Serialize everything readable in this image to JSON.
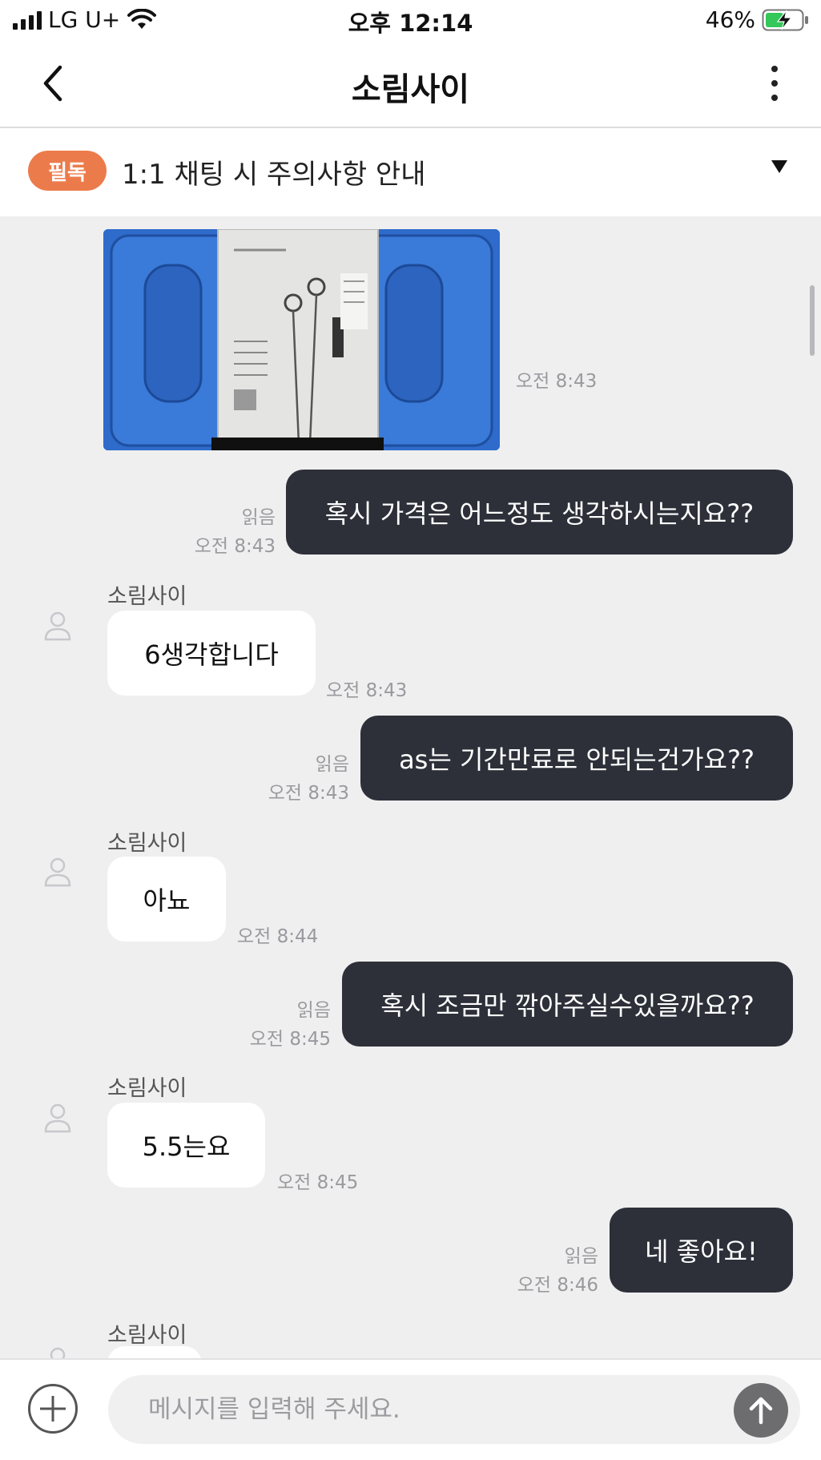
{
  "status_bar": {
    "carrier": "LG U+",
    "time": "오후 12:14",
    "battery": "46%"
  },
  "header": {
    "title": "소림사이"
  },
  "notice": {
    "badge": "필독",
    "text": "1:1 채팅 시 주의사항 안내"
  },
  "messages": [
    {
      "type": "image",
      "time": "오전 8:43",
      "subject": "earphones-box"
    },
    {
      "type": "outgoing",
      "text": "혹시 가격은 어느정도 생각하시는지요??",
      "read": "읽음",
      "time": "오전 8:43"
    },
    {
      "type": "incoming",
      "sender": "소림사이",
      "text": "6생각합니다",
      "time": "오전 8:43"
    },
    {
      "type": "outgoing",
      "text": "as는 기간만료로 안되는건가요??",
      "read": "읽음",
      "time": "오전 8:43"
    },
    {
      "type": "incoming",
      "sender": "소림사이",
      "text": "아뇨",
      "time": "오전 8:44"
    },
    {
      "type": "outgoing",
      "text": "혹시 조금만 깎아주실수있을까요??",
      "read": "읽음",
      "time": "오전 8:45"
    },
    {
      "type": "incoming",
      "sender": "소림사이",
      "text": "5.5는요",
      "time": "오전 8:45"
    },
    {
      "type": "outgoing",
      "text": "네 좋아요!",
      "read": "읽음",
      "time": "오전 8:46"
    },
    {
      "type": "incoming",
      "sender": "소림사이",
      "text": "",
      "time": ""
    }
  ],
  "input": {
    "placeholder": "메시지를 입력해 주세요."
  },
  "icons": {
    "back": "chevron-left-icon",
    "more": "more-vertical-icon",
    "add": "plus-circle-icon",
    "send": "arrow-up-icon",
    "avatar": "user-icon"
  },
  "colors": {
    "notice_badge": "#ec7b4b",
    "outgoing_bubble": "#2d3039",
    "incoming_bubble": "#ffffff",
    "chat_background": "#efeff0",
    "send_button": "#6d6d70",
    "battery_fill": "#34c759"
  }
}
